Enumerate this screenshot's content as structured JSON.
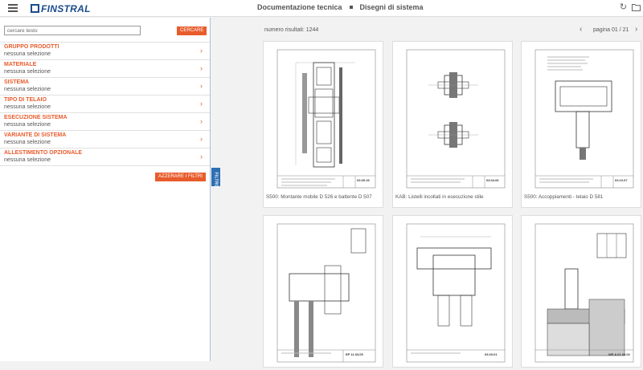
{
  "header": {
    "logo_text": "FINSTRAL",
    "breadcrumb": [
      "Documentazione tecnica",
      "Disegni di sistema"
    ]
  },
  "search": {
    "placeholder": "cercare testo",
    "button_label": "CERCARE"
  },
  "filters": [
    {
      "title": "GRUPPO PRODOTTI",
      "value": "nessuna selezione"
    },
    {
      "title": "MATERIALE",
      "value": "nessuna selezione"
    },
    {
      "title": "SISTEMA",
      "value": "nessuna selezione"
    },
    {
      "title": "TIPO DI TELAIO",
      "value": "nessuna selezione"
    },
    {
      "title": "ESECUZIONE SISTEMA",
      "value": "nessuna selezione"
    },
    {
      "title": "VARIANTE DI SISTEMA",
      "value": "nessuna selezione"
    },
    {
      "title": "ALLESTIMENTO OPZIONALE",
      "value": "nessuna selezione"
    }
  ],
  "reset_button_label": "AZZERARE I FILTRI",
  "filter_tab_label": "FILTRO",
  "results": {
    "count_label": "numero risultati: 1244",
    "page_label": "pagina 01 / 21"
  },
  "cards": [
    {
      "caption": "S500: Montante mobile D 526 e battente D 507",
      "code": "03.05.15"
    },
    {
      "caption": "KAB: Listelli incollati in esecuzione stile",
      "code": "03.04.06"
    },
    {
      "caption": "S500: Accoppiamenti - telaio D 581",
      "code": "03.10.07"
    },
    {
      "caption": "",
      "code": "EP 11.03.05"
    },
    {
      "caption": "",
      "code": "03.03.01"
    },
    {
      "caption": "",
      "code": "WE A 01.04.02"
    }
  ],
  "colors": {
    "accent": "#e85c2c",
    "brand": "#1b4c8c",
    "tab": "#2d6fb3"
  }
}
